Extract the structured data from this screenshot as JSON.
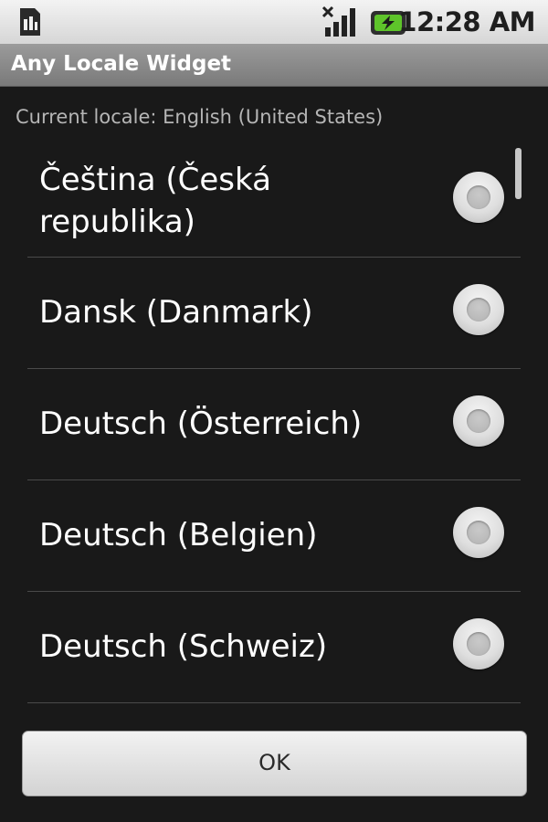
{
  "status_bar": {
    "time": "12:28 AM",
    "icons": [
      "sim-card-icon",
      "signal-strength-icon",
      "battery-charging-icon"
    ]
  },
  "title_bar": {
    "title": "Any Locale Widget"
  },
  "current_locale_text": "Current locale: English (United States)",
  "locales": [
    {
      "label": "Čeština (Česká republika)",
      "selected": false
    },
    {
      "label": "Dansk (Danmark)",
      "selected": false
    },
    {
      "label": "Deutsch (Österreich)",
      "selected": false
    },
    {
      "label": "Deutsch (Belgien)",
      "selected": false
    },
    {
      "label": "Deutsch (Schweiz)",
      "selected": false
    }
  ],
  "ok_button": {
    "label": "OK"
  },
  "colors": {
    "background": "#191919",
    "status_bar": "#e5e5e5",
    "title_bar": "#8a8a8a",
    "divider": "#4a4a4a",
    "text_primary": "#ffffff",
    "text_secondary": "#b5b5b5"
  }
}
